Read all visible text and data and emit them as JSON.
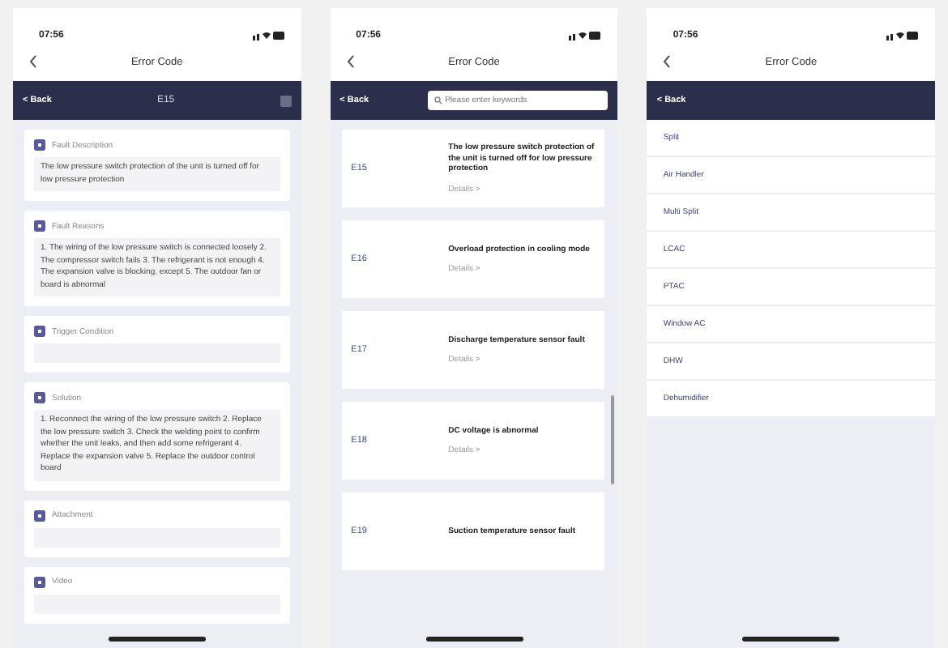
{
  "screens": [
    {
      "kind": "detail",
      "time": "07:56",
      "title": "Error Code",
      "back": "< Back",
      "code": "E15",
      "sections": [
        {
          "heading": "Fault Description",
          "body": "The low pressure switch protection of the unit is turned off for low pressure protection"
        },
        {
          "heading": "Fault Reasons",
          "body": "1. The wiring of the low pressure switch is connected loosely 2. The compressor switch fails 3. The refrigerant is not enough 4. The expansion valve is blocking, except 5. The outdoor fan or board is abnormal"
        },
        {
          "heading": "Trigger Condition"
        },
        {
          "heading": "Solution",
          "body": "1. Reconnect the wiring of the low pressure switch 2. Replace the low pressure switch 3. Check the welding point to confirm whether the unit leaks, and then add some refrigerant 4. Replace the expansion valve 5. Replace the outdoor control board"
        },
        {
          "heading": "Attachment"
        },
        {
          "heading": "Video"
        }
      ]
    },
    {
      "kind": "list",
      "time": "07:56",
      "title": "Error Code",
      "back": "< Back",
      "search": {
        "placeholder": "Please enter keywords"
      },
      "rows": [
        {
          "code": "E15",
          "text": "The low pressure switch protection of the unit is turned off for low pressure protection",
          "link": "Details >"
        },
        {
          "code": "E16",
          "text": "Overload protection in cooling mode",
          "link": "Details >"
        },
        {
          "code": "E17",
          "text": "Discharge temperature sensor fault",
          "link": "Details >"
        },
        {
          "code": "E18",
          "text": "DC voltage is abnormal",
          "link": "Details >"
        },
        {
          "code": "E19",
          "text": "Suction temperature sensor fault"
        }
      ]
    },
    {
      "kind": "categories",
      "time": "07:56",
      "title": "Error Code",
      "back": "< Back",
      "items": [
        "Split",
        "Air Handler",
        "Multi Split",
        "LCAC",
        "PTAC",
        "Window AC",
        "DHW",
        "Dehumidifier"
      ]
    }
  ]
}
